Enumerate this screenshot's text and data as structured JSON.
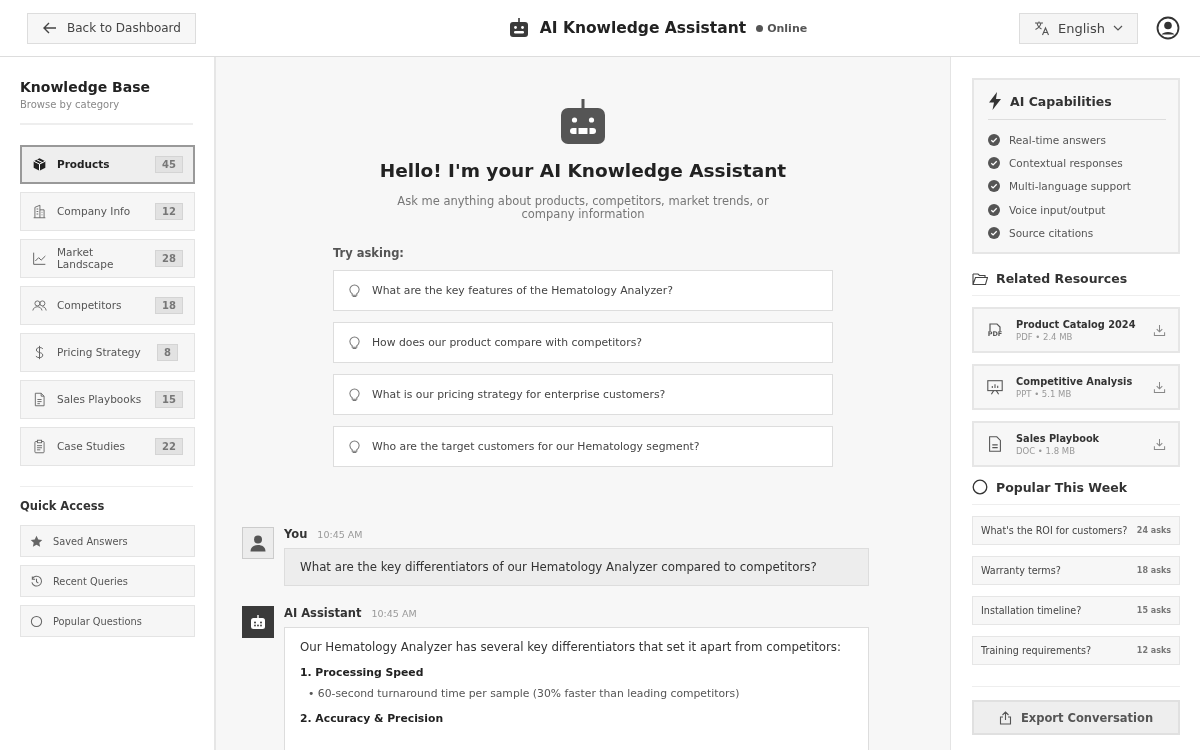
{
  "header": {
    "back_button": "Back to Dashboard",
    "title": "AI Knowledge Assistant",
    "status": {
      "label": "Online",
      "online": true
    },
    "language": "English"
  },
  "sidebar": {
    "title": "Knowledge Base",
    "subtitle": "Browse by category",
    "categories": [
      {
        "label": "Products",
        "count": "45",
        "selected": true
      },
      {
        "label": "Company Info",
        "count": "12",
        "selected": false
      },
      {
        "label": "Market Landscape",
        "count": "28",
        "selected": false
      },
      {
        "label": "Competitors",
        "count": "18",
        "selected": false
      },
      {
        "label": "Pricing Strategy",
        "count": "8",
        "selected": false
      },
      {
        "label": "Sales Playbooks",
        "count": "15",
        "selected": false
      },
      {
        "label": "Case Studies",
        "count": "22",
        "selected": false
      }
    ],
    "quick_access_title": "Quick Access",
    "quick_access": [
      {
        "label": "Saved Answers"
      },
      {
        "label": "Recent Queries"
      },
      {
        "label": "Popular Questions"
      }
    ]
  },
  "welcome": {
    "title": "Hello! I'm your AI Knowledge Assistant",
    "subtitle": "Ask me anything about products, competitors, market trends, or company information",
    "suggestions_label": "Try asking:",
    "suggestions": [
      "What are the key features of the Hematology Analyzer?",
      "How does our product compare with competitors?",
      "What is our pricing strategy for enterprise customers?",
      "Who are the target customers for our Hematology segment?"
    ]
  },
  "messages": [
    {
      "kind": "user",
      "author": "You",
      "time": "10:45 AM",
      "text": "What are the key differentiators of our Hematology Analyzer compared to competitors?"
    },
    {
      "kind": "assistant",
      "author": "AI Assistant",
      "time": "10:45 AM",
      "text": "Our Hematology Analyzer has several key differentiators that set it apart from competitors:",
      "sections": [
        {
          "heading": "1. Processing Speed",
          "bullets": [
            "• 60-second turnaround time per sample (30% faster than leading competitors)"
          ]
        },
        {
          "heading": "2. Accuracy & Precision"
        }
      ]
    }
  ],
  "capabilities": {
    "title": "AI Capabilities",
    "items": [
      {
        "label": "Real-time answers",
        "checked": true
      },
      {
        "label": "Contextual responses",
        "checked": true
      },
      {
        "label": "Multi-language support",
        "checked": true
      },
      {
        "label": "Voice input/output",
        "checked": true
      },
      {
        "label": "Source citations",
        "checked": true
      }
    ]
  },
  "resources": {
    "title": "Related Resources",
    "items": [
      {
        "kind": "pdf",
        "icon_label": "PDF",
        "name": "Product Catalog 2024",
        "meta": "PDF • 2.4 MB"
      },
      {
        "kind": "ppt",
        "name": "Competitive Analysis",
        "meta": "PPT • 5.1 MB"
      },
      {
        "kind": "doc",
        "name": "Sales Playbook",
        "meta": "DOC • 1.8 MB"
      }
    ]
  },
  "popular": {
    "title": "Popular This Week",
    "items": [
      {
        "question": "What's the ROI for customers?",
        "count": "24 asks"
      },
      {
        "question": "Warranty terms?",
        "count": "18 asks"
      },
      {
        "question": "Installation timeline?",
        "count": "15 asks"
      },
      {
        "question": "Training requirements?",
        "count": "12 asks"
      }
    ]
  },
  "export_button": "Export Conversation"
}
